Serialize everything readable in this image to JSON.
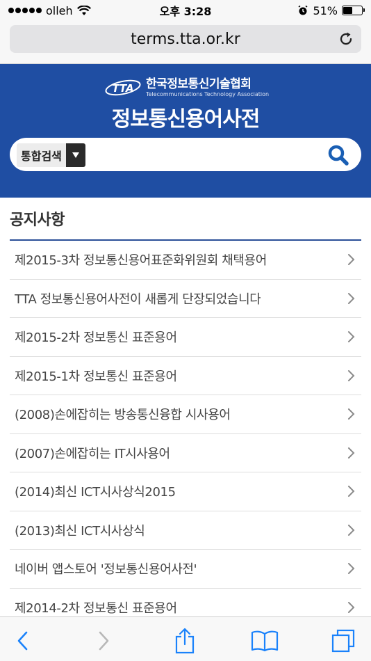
{
  "status_bar": {
    "carrier": "olleh",
    "time": "오후 3:28",
    "battery_percent": "51%",
    "battery_level": 0.51
  },
  "browser": {
    "url": "terms.tta.or.kr"
  },
  "header": {
    "logo_mark": "TTA",
    "logo_org_kr": "한국정보통신기술협회",
    "logo_org_en": "Telecommunications Technology Association",
    "site_title": "정보통신용어사전"
  },
  "search": {
    "scope_label": "통합검색",
    "query": ""
  },
  "notice": {
    "title": "공지사항",
    "items": [
      "제2015-3차 정보통신용어표준화위원회 채택용어",
      "TTA 정보통신용어사전이 새롭게 단장되었습니다",
      "제2015-2차 정보통신 표준용어",
      "제2015-1차 정보통신 표준용어",
      "(2008)손에잡히는 방송통신융합 시사용어",
      "(2007)손에잡히는 IT시사용어",
      "(2014)최신 ICT시사상식2015",
      "(2013)최신 ICT시사상식",
      "네이버 앱스토어 '정보통신용어사전'",
      "제2014-2차 정보통신 표준용어"
    ]
  },
  "colors": {
    "banner": "#1f4ea3",
    "accent_blue": "#1a5fb4",
    "ios_blue": "#1a82fb"
  }
}
